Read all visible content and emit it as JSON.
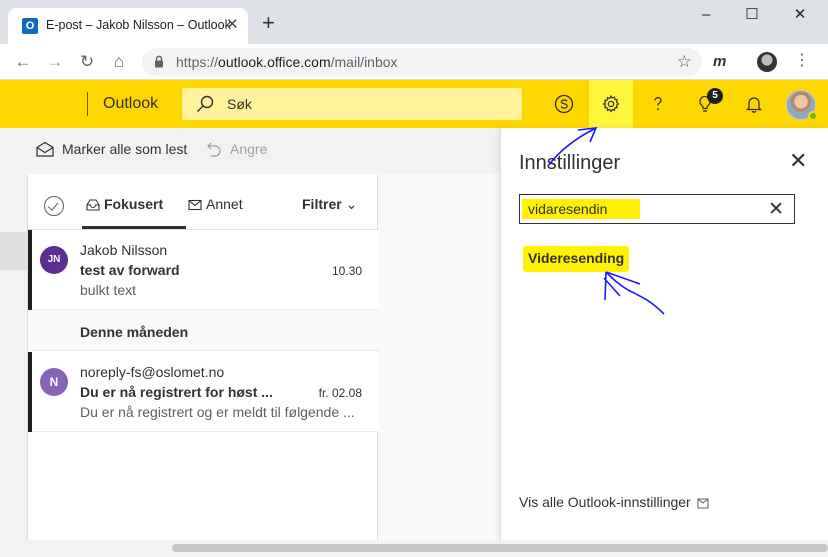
{
  "browser": {
    "tab_title": "E-post – Jakob Nilsson – Outlook",
    "favicon_letter": "O",
    "tab_close": "✕",
    "new_tab": "+",
    "window_controls": {
      "minimize": "–",
      "maximize": "☐",
      "close": "✕"
    },
    "nav": {
      "back": "←",
      "forward": "→",
      "reload": "↻",
      "home": "⌂"
    },
    "url_prefix": "https://",
    "url_host": "outlook.office.com",
    "url_path": "/mail/inbox",
    "star": "☆",
    "extension_letter": "m",
    "menu": "⋮"
  },
  "header": {
    "brand": "Outlook",
    "search_placeholder": "Søk",
    "notifications_count": "5",
    "icons": [
      "skype-icon",
      "gear-icon",
      "help-icon",
      "lightbulb-icon",
      "bell-icon"
    ]
  },
  "commands": {
    "mark_all_read": "Marker alle som lest",
    "undo": "Angre"
  },
  "message_list": {
    "pivot_focused": "Fokusert",
    "pivot_other": "Annet",
    "filter": "Filtrer",
    "filter_chevron": "⌄",
    "section_month": "Denne måneden",
    "messages": [
      {
        "initials": "JN",
        "avatar_color": "#5c2e91",
        "from": "Jakob Nilsson",
        "subject": "test av forward",
        "time": "10.30",
        "preview": "bulkt text"
      },
      {
        "initials": "N",
        "avatar_color": "#8764b8",
        "from": "noreply-fs@oslomet.no",
        "subject": "Du er nå registrert for høst ...",
        "time": "fr. 02.08",
        "preview": "Du er nå registrert og er meldt til følgende ..."
      }
    ]
  },
  "settings": {
    "title": "Innstillinger",
    "close": "✕",
    "search_value": "vidaresendin",
    "clear": "✕",
    "result": "Videresending",
    "footer_link": "Vis alle Outlook-innstillinger"
  },
  "colors": {
    "header_yellow": "#ffd700",
    "highlight_yellow": "#fff200",
    "annotation_blue": "#1a1aff"
  }
}
